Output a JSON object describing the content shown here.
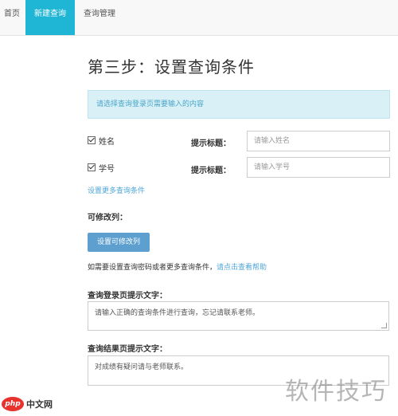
{
  "nav": {
    "tabs": [
      {
        "label": "首页"
      },
      {
        "label": "新建查询"
      },
      {
        "label": "查询管理"
      }
    ],
    "active_index": 1
  },
  "page_title": "第三步：设置查询条件",
  "alert_text": "请选择查询登录页需要输入的内容",
  "conditions": [
    {
      "label": "姓名",
      "checked": true,
      "hint_label": "提示标题：",
      "placeholder": "请输入姓名"
    },
    {
      "label": "学号",
      "checked": true,
      "hint_label": "提示标题：",
      "placeholder": "请输入学号"
    }
  ],
  "more_conditions_link": "设置更多查询条件",
  "editable_columns_label": "可修改列：",
  "set_editable_button": "设置可修改列",
  "info": {
    "text": "如需要设置查询密码或者更多查询条件，",
    "link": "请点击查看帮助"
  },
  "login_prompt": {
    "label": "查询登录页提示文字：",
    "value": "请输入正确的查询条件进行查询，忘记请联系老师。"
  },
  "result_prompt": {
    "label": "查询结果页提示文字：",
    "value": "对成绩有疑问请与老师联系。"
  },
  "watermarks": {
    "left_logo": "php",
    "left_text": "中文网",
    "right_text": "软件技巧"
  },
  "colors": {
    "nav_active": "#1fb5d4",
    "alert_bg": "#d9f0f7",
    "alert_text": "#4aa6c9",
    "button_bg": "#5d9fcf",
    "link": "#4da6d9"
  }
}
